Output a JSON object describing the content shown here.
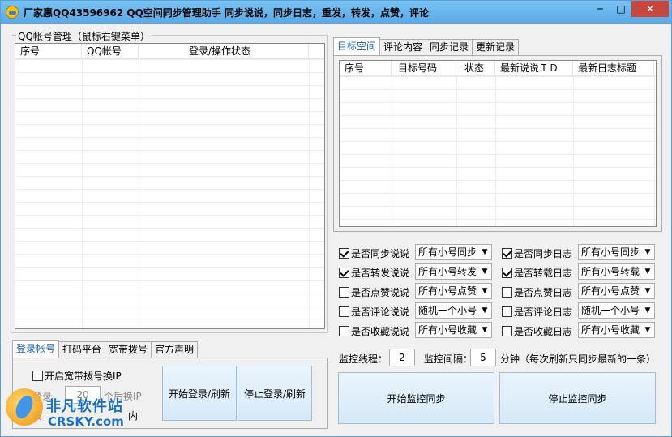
{
  "window": {
    "title": "厂家惠QQ43596962 QQ空间同步管理助手  同步说说，同步日志，重发，转发，点赞，评论",
    "min_glyph": "─",
    "max_glyph": "□",
    "close_glyph": "✕"
  },
  "accounts": {
    "group_title": "QQ帐号管理（鼠标右键菜单）",
    "columns": [
      "序号",
      "QQ帐号",
      "登录/操作状态"
    ]
  },
  "bottom_tabs": {
    "tabs": [
      "登录帐号",
      "打码平台",
      "宽带拨号",
      "官方声明"
    ],
    "enable_dial_label": "开启宽带拨号换IP",
    "login_prefix": "登录",
    "login_value": "20",
    "login_suffix": "个后换IP",
    "partial_label": "设",
    "partial_suffix": "内",
    "start_login": "开始登录/刷新",
    "stop_login": "停止登录/刷新"
  },
  "right_tabs": {
    "tabs": [
      "目标空间",
      "评论内容",
      "同步记录",
      "更新记录"
    ],
    "columns": [
      "序号",
      "目标号码",
      "状态",
      "最新说说ＩＤ",
      "最新日志标题"
    ]
  },
  "options": {
    "left": [
      {
        "label": "是否同步说说",
        "checked": true,
        "select": "所有小号同步"
      },
      {
        "label": "是否转发说说",
        "checked": true,
        "select": "所有小号转发"
      },
      {
        "label": "是否点赞说说",
        "checked": false,
        "select": "所有小号点赞"
      },
      {
        "label": "是否评论说说",
        "checked": false,
        "select": "随机一个小号"
      },
      {
        "label": "是否收藏说说",
        "checked": false,
        "select": "所有小号收藏"
      }
    ],
    "right": [
      {
        "label": "是否同步日志",
        "checked": true,
        "select": "所有小号同步"
      },
      {
        "label": "是否转载日志",
        "checked": true,
        "select": "所有小号转载"
      },
      {
        "label": "是否点赞日志",
        "checked": false,
        "select": "所有小号点赞"
      },
      {
        "label": "是否评论日志",
        "checked": false,
        "select": "随机一个小号"
      },
      {
        "label": "是否收藏日志",
        "checked": false,
        "select": "所有小号收藏"
      }
    ]
  },
  "monitor": {
    "threads_label": "监控线程：",
    "threads_value": "2",
    "interval_label": "监控间隔：",
    "interval_value": "5",
    "interval_suffix": "分钟（每次刷新只同步最新的一条）",
    "start": "开始监控同步",
    "stop": "停止监控同步"
  },
  "watermark": {
    "cn": "非凡软件站",
    "en": "CRSKY.com"
  }
}
